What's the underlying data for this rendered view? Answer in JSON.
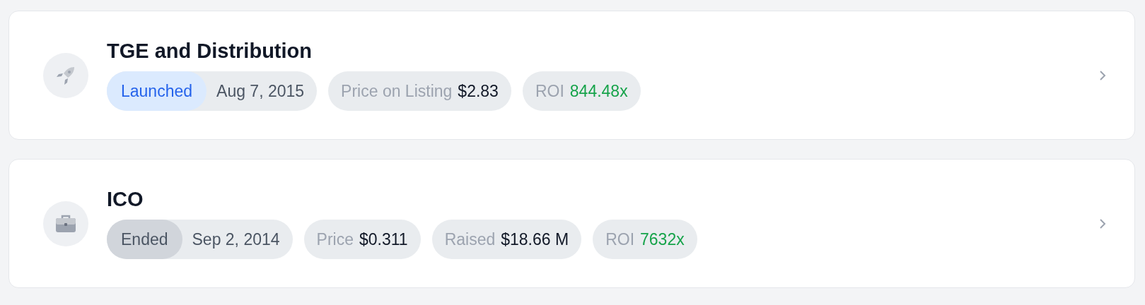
{
  "events": [
    {
      "title": "TGE and Distribution",
      "status": {
        "label": "Launched",
        "kind": "launched"
      },
      "date": "Aug 7, 2015",
      "stats": [
        {
          "label": "Price on Listing",
          "value": "$2.83",
          "kind": "plain"
        },
        {
          "label": "ROI",
          "value": "844.48x",
          "kind": "gain"
        }
      ]
    },
    {
      "title": "ICO",
      "status": {
        "label": "Ended",
        "kind": "ended"
      },
      "date": "Sep 2, 2014",
      "stats": [
        {
          "label": "Price",
          "value": "$0.311",
          "kind": "plain"
        },
        {
          "label": "Raised",
          "value": "$18.66 M",
          "kind": "plain"
        },
        {
          "label": "ROI",
          "value": "7632x",
          "kind": "gain"
        }
      ]
    }
  ]
}
